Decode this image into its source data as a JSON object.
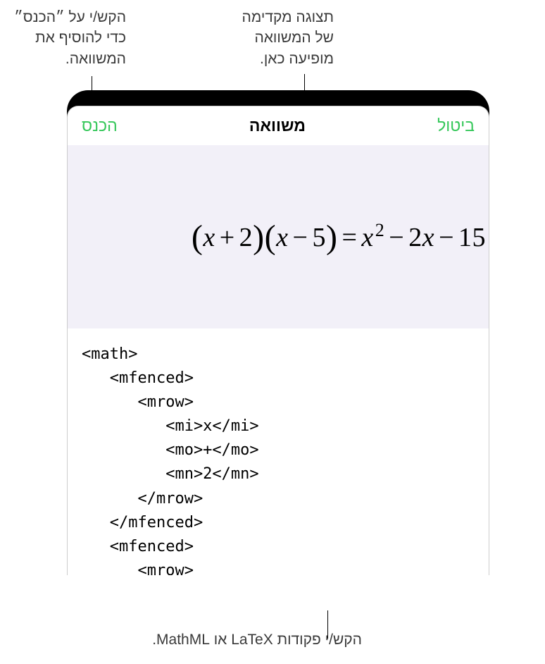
{
  "callouts": {
    "insert_hint": "הקש/י על ״הכנס״ כדי להוסיף את המשוואה.",
    "preview_hint": "תצוגה מקדימה של המשוואה מופיעה כאן.",
    "code_hint": "הקש/י פקודות LaTeX או MathML."
  },
  "nav": {
    "cancel": "ביטול",
    "title": "משוואה",
    "insert": "הכנס"
  },
  "equation": {
    "display_text": "(x + 2)(x − 5) = x² − 2x − 15"
  },
  "code": {
    "content": "<math>\n   <mfenced>\n      <mrow>\n         <mi>x</mi>\n         <mo>+</mo>\n         <mn>2</mn>\n      </mrow>\n   </mfenced>\n   <mfenced>\n      <mrow>"
  }
}
